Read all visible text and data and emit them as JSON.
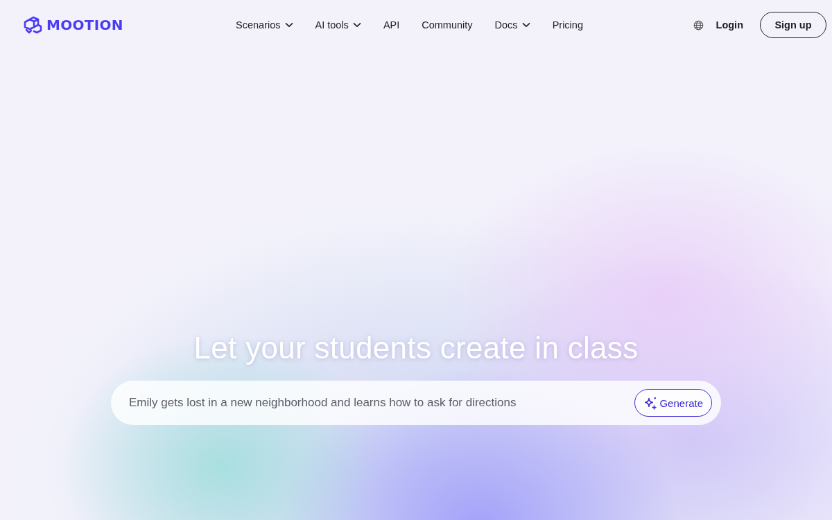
{
  "header": {
    "logo": {
      "text": "MOOTION"
    },
    "nav": [
      {
        "label": "Scenarios",
        "dropdown": true
      },
      {
        "label": "AI tools",
        "dropdown": true
      },
      {
        "label": "API",
        "dropdown": false
      },
      {
        "label": "Community",
        "dropdown": false
      },
      {
        "label": "Docs",
        "dropdown": true
      },
      {
        "label": "Pricing",
        "dropdown": false
      }
    ],
    "login": "Login",
    "signup": "Sign up"
  },
  "hero": {
    "headline": "Let your students create in class",
    "prompt": {
      "placeholder": "Emily gets lost in a new neighborhood and learns how to ask for directions"
    },
    "generate": "Generate"
  }
}
